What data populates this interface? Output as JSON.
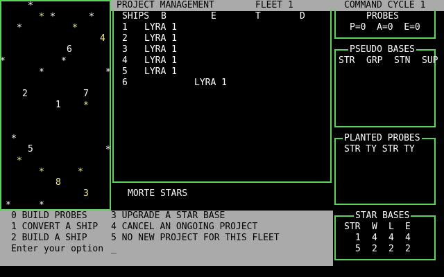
{
  "header": {
    "project_title": "PROJECT MANAGEMENT",
    "fleet_label": "FLEET 1",
    "cycle_label": "COMMAND CYCLE 1"
  },
  "ships_panel": {
    "columns": [
      "SHIPS",
      "B",
      "E",
      "T",
      "D"
    ],
    "rows": [
      {
        "num": "1",
        "col": "B",
        "name": "LYRA 1"
      },
      {
        "num": "2",
        "col": "B",
        "name": "LYRA 1"
      },
      {
        "num": "3",
        "col": "B",
        "name": "LYRA 1"
      },
      {
        "num": "4",
        "col": "B",
        "name": "LYRA 1"
      },
      {
        "num": "5",
        "col": "B",
        "name": "LYRA 1"
      },
      {
        "num": "6",
        "col": "E",
        "name": "LYRA 1"
      }
    ],
    "footer": "MORTE STARS"
  },
  "probes": {
    "title": "PROBES",
    "values": "P=0  A=0  E=0"
  },
  "pseudo_bases": {
    "title": "PSEUDO BASES",
    "columns": [
      "STR",
      "GRP",
      "STN",
      "SUP"
    ]
  },
  "planted_probes": {
    "title": "PLANTED PROBES",
    "columns": "STR TY STR TY"
  },
  "star_bases": {
    "title": "STAR BASES",
    "columns": [
      "STR",
      "W",
      "L",
      "E"
    ],
    "rows": [
      [
        "1",
        "4",
        "4",
        "4"
      ],
      [
        "5",
        "2",
        "2",
        "2"
      ]
    ]
  },
  "menu": {
    "left": [
      "0 BUILD PROBES",
      "1 CONVERT A SHIP",
      "2 BUILD A SHIP"
    ],
    "right": [
      "3 UPGRADE A STAR BASE",
      "4 CANCEL AN ONGOING PROJECT",
      "5 NO NEW PROJECT FOR THIS FLEET"
    ],
    "prompt": "Enter your option"
  },
  "starmap": {
    "stars": [
      {
        "color": "#ffffff"
      },
      {
        "color": "#f2f25a"
      },
      {
        "color": "#ffffff"
      },
      {
        "color": "#ffffff"
      },
      {
        "color": "#ffffff"
      },
      {
        "color": "#f2f25a"
      },
      {
        "color": "#ffffff"
      },
      {
        "color": "#ffffff"
      },
      {
        "color": "#ffffff"
      },
      {
        "color": "#ffffff"
      },
      {
        "color": "#f2f25a"
      },
      {
        "color": "#ffffff"
      },
      {
        "color": "#ffffff"
      },
      {
        "color": "#f2f25a"
      },
      {
        "color": "#f2f25a"
      },
      {
        "color": "#f2f25a"
      },
      {
        "color": "#ffffff"
      },
      {
        "color": "#ffffff"
      }
    ],
    "systems": [
      {
        "label": "4",
        "color": "#f2f25a"
      },
      {
        "label": "6",
        "color": "#ffffff"
      },
      {
        "label": "2",
        "color": "#ffffff"
      },
      {
        "label": "7",
        "color": "#ffffff"
      },
      {
        "label": "1",
        "color": "#ffffff"
      },
      {
        "label": "5",
        "color": "#ffffff"
      },
      {
        "label": "8",
        "color": "#f2f25a"
      },
      {
        "label": "3",
        "color": "#f2f25a"
      }
    ]
  },
  "colors": {
    "panel_border": "#59d659",
    "header_bar": "#aaaaaa",
    "menu_bg": "#aaaaaa",
    "highlight": "#f2f25a"
  }
}
